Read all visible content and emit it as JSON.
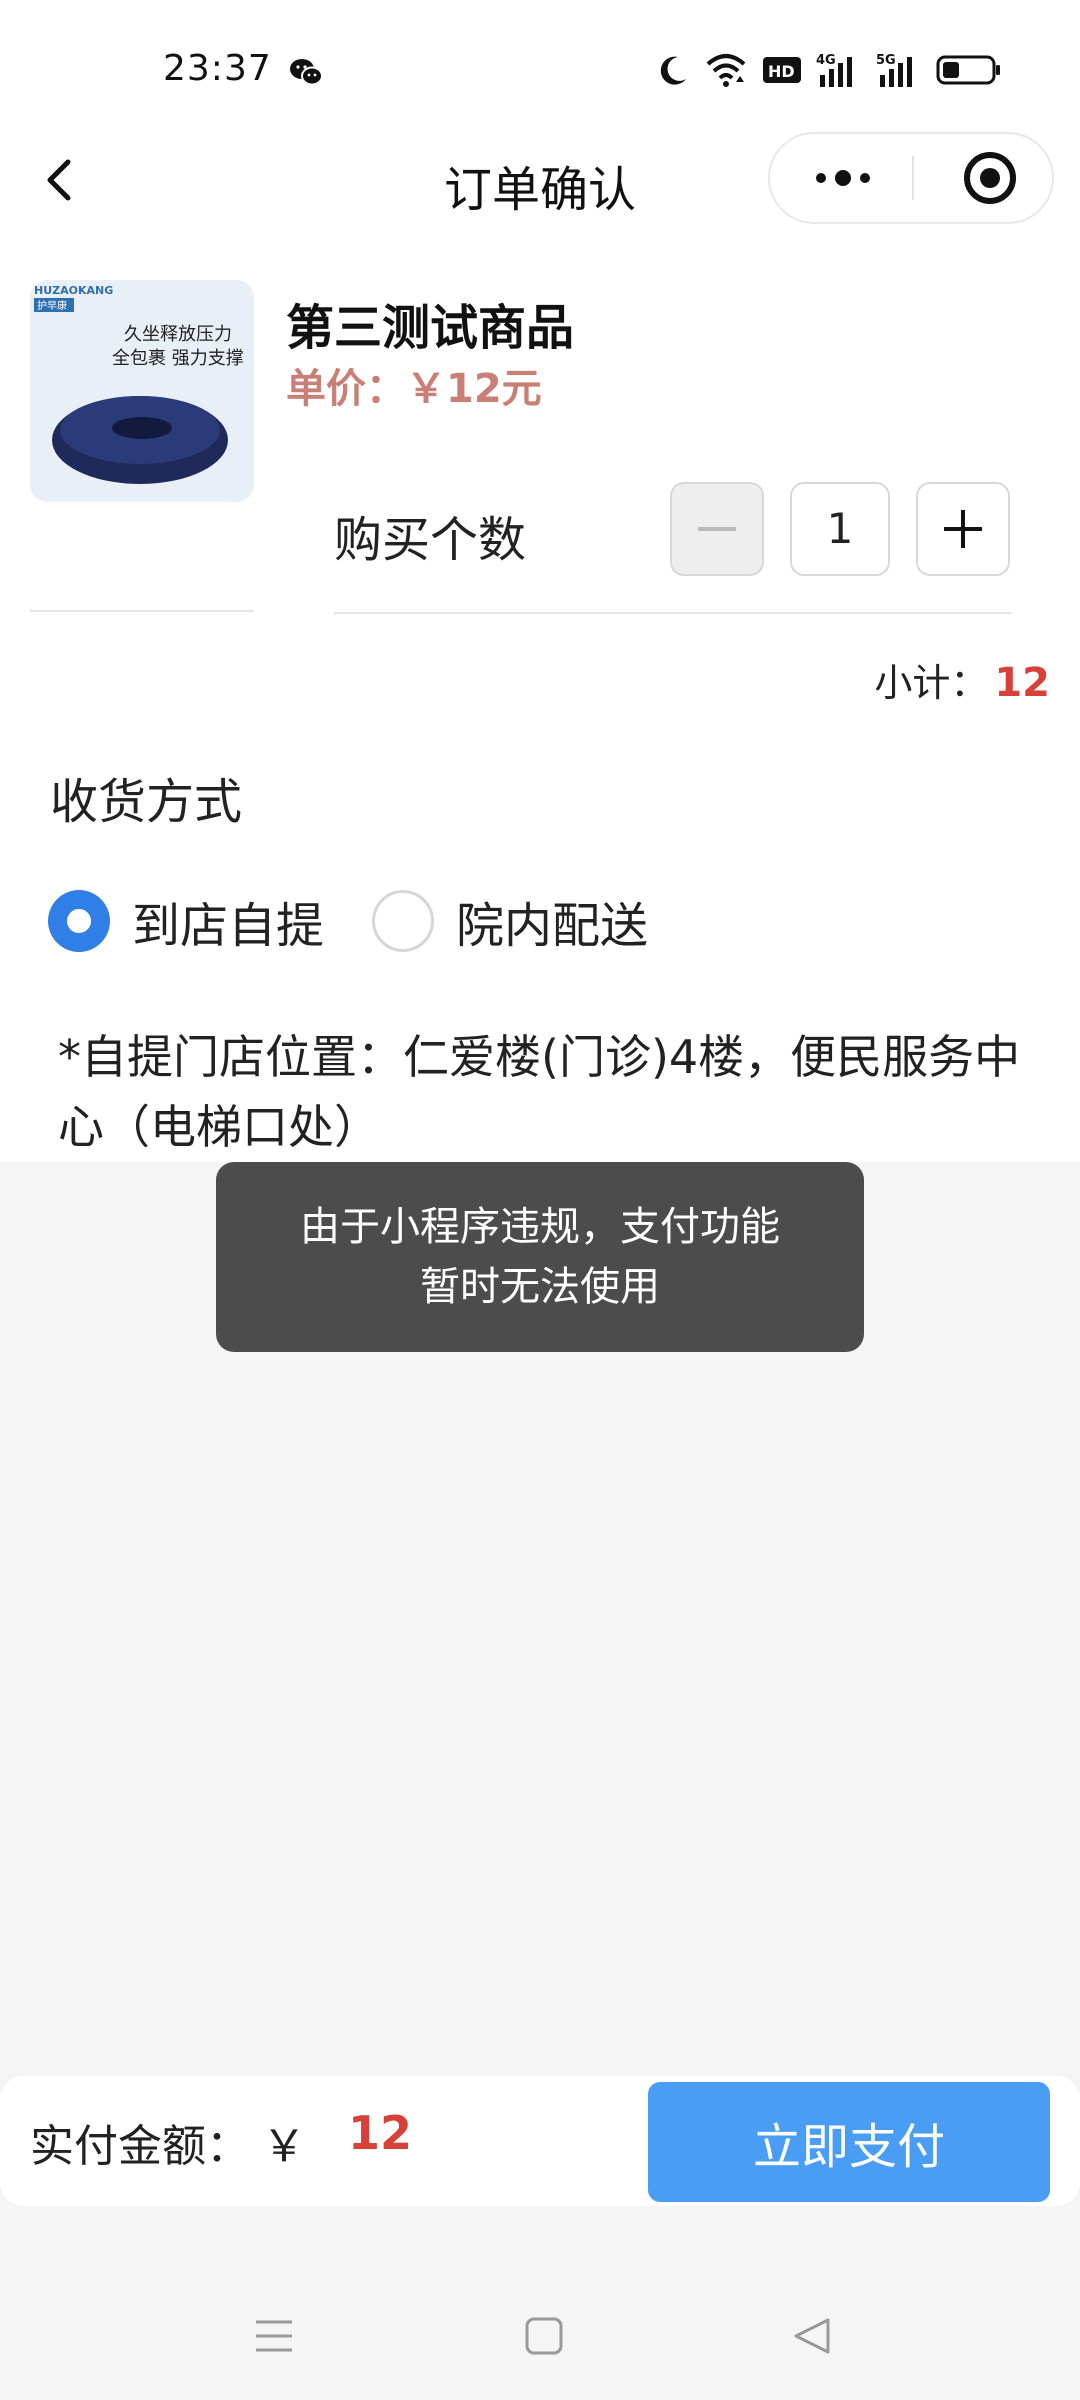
{
  "status_bar": {
    "time": "23:37"
  },
  "nav": {
    "title": "订单确认"
  },
  "product": {
    "name": "第三测试商品",
    "unit_price": "单价：￥12元",
    "image": {
      "brand": "HUZAOKANG 护早康",
      "tagline_1": "久坐释放压力",
      "tagline_2": "全包裹 强力支撑"
    }
  },
  "quantity": {
    "label": "购买个数",
    "value": "1"
  },
  "subtotal": {
    "label": "小计：",
    "value": "12"
  },
  "delivery": {
    "title": "收货方式",
    "options": [
      {
        "label": "到店自提",
        "checked": true
      },
      {
        "label": "院内配送",
        "checked": false
      }
    ],
    "pickup_note": "*自提门店位置：仁爱楼(门诊)4楼，便民服务中心（电梯口处）"
  },
  "toast": {
    "line1": "由于小程序违规，支付功能",
    "line2": "暂时无法使用"
  },
  "payment": {
    "label": "实付金额：",
    "currency": "￥",
    "amount": "12",
    "button_label": "立即支付"
  },
  "colors": {
    "accent_blue": "#2f7fe6",
    "pay_button": "#4a9df5",
    "price_red": "#d8403a",
    "unit_price": "#c97f76"
  }
}
